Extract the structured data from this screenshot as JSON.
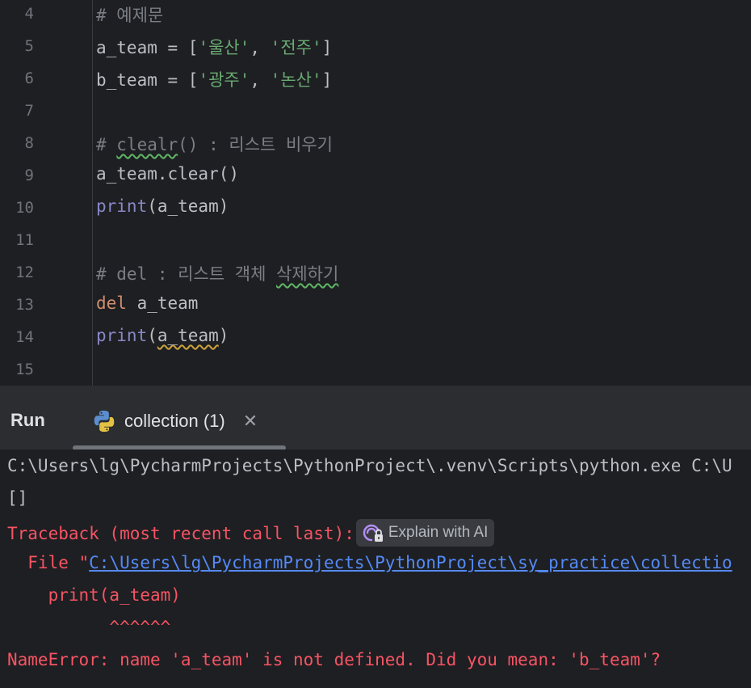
{
  "editor": {
    "lines": [
      {
        "num": "4",
        "tokens": [
          {
            "t": "# 예제문",
            "c": "com"
          }
        ]
      },
      {
        "num": "5",
        "tokens": [
          {
            "t": "a_team = [",
            "c": ""
          },
          {
            "t": "'울산'",
            "c": "str"
          },
          {
            "t": ", ",
            "c": ""
          },
          {
            "t": "'전주'",
            "c": "str"
          },
          {
            "t": "]",
            "c": ""
          }
        ]
      },
      {
        "num": "6",
        "tokens": [
          {
            "t": "b_team = [",
            "c": ""
          },
          {
            "t": "'광주'",
            "c": "str"
          },
          {
            "t": ", ",
            "c": ""
          },
          {
            "t": "'논산'",
            "c": "str"
          },
          {
            "t": "]",
            "c": ""
          }
        ]
      },
      {
        "num": "7",
        "tokens": []
      },
      {
        "num": "8",
        "tokens": [
          {
            "t": "# ",
            "c": "com"
          },
          {
            "t": "clealr",
            "c": "com wavy-green"
          },
          {
            "t": "() : 리스트 비우기",
            "c": "com"
          }
        ]
      },
      {
        "num": "9",
        "tokens": [
          {
            "t": "a_team.clear()",
            "c": ""
          }
        ]
      },
      {
        "num": "10",
        "tokens": [
          {
            "t": "print",
            "c": "fn"
          },
          {
            "t": "(a_team)",
            "c": ""
          }
        ]
      },
      {
        "num": "11",
        "tokens": []
      },
      {
        "num": "12",
        "tokens": [
          {
            "t": "# del : 리스트 객체 ",
            "c": "com"
          },
          {
            "t": "삭제하기",
            "c": "com wavy-green"
          }
        ]
      },
      {
        "num": "13",
        "tokens": [
          {
            "t": "del",
            "c": "kw"
          },
          {
            "t": " a_team",
            "c": ""
          }
        ]
      },
      {
        "num": "14",
        "tokens": [
          {
            "t": "print",
            "c": "fn"
          },
          {
            "t": "(",
            "c": ""
          },
          {
            "t": "a_team",
            "c": "wavy-yellow"
          },
          {
            "t": ")",
            "c": ""
          }
        ]
      },
      {
        "num": "15",
        "tokens": []
      }
    ]
  },
  "run_panel": {
    "title": "Run",
    "tab_label": "collection (1)",
    "tab_icon": "python-icon",
    "close_symbol": "✕"
  },
  "console": {
    "cmd_line": "C:\\Users\\lg\\PycharmProjects\\PythonProject\\.venv\\Scripts\\python.exe C:\\U",
    "output_line": "[]",
    "traceback_header": "Traceback (most recent call last):",
    "explain_ai_label": "Explain with AI",
    "file_prefix": "  File \"",
    "file_link": "C:\\Users\\lg\\PycharmProjects\\PythonProject\\sy_practice\\collectio",
    "source_line": "    print(a_team)",
    "caret_line": "          ^^^^^^",
    "error_line": "NameError: name 'a_team' is not defined. Did you mean: 'b_team'?"
  },
  "colors": {
    "background": "#1e1f22",
    "panel_header": "#2b2d30",
    "error": "#f75464",
    "link": "#548af7",
    "string": "#6aab73",
    "keyword": "#cf8e6d",
    "builtin": "#8888c6",
    "comment": "#7a7e85"
  }
}
